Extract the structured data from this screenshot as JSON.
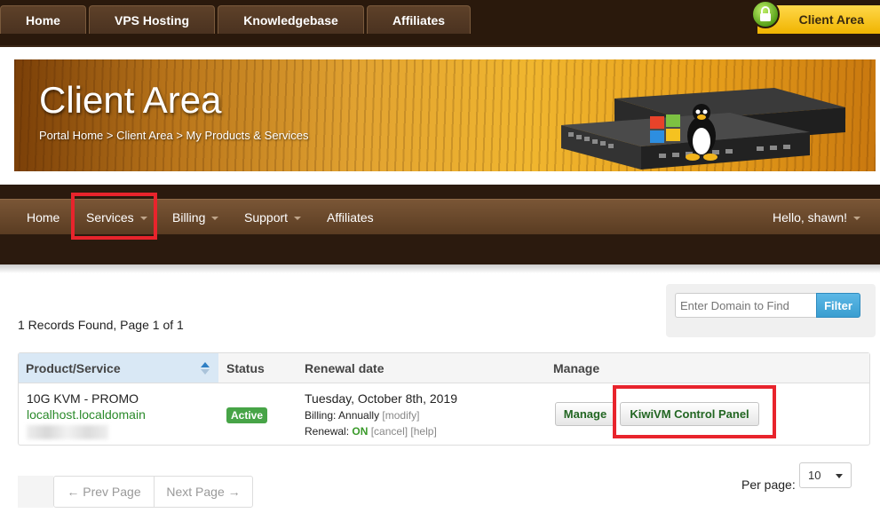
{
  "top_tabs": [
    "Home",
    "VPS Hosting",
    "Knowledgebase",
    "Affiliates"
  ],
  "client_area_tab": "Client Area",
  "banner": {
    "title": "Client Area",
    "breadcrumb": [
      "Portal Home",
      "Client Area",
      "My Products & Services"
    ],
    "breadcrumb_sep": ">"
  },
  "nav": {
    "items": [
      "Home",
      "Services",
      "Billing",
      "Support",
      "Affiliates"
    ],
    "greeting": "Hello, shawn!"
  },
  "records": {
    "prefix": "1 Records Found, Page ",
    "page": "1",
    "middle": " of ",
    "total": "1"
  },
  "filter": {
    "placeholder": "Enter Domain to Find",
    "button": "Filter"
  },
  "table": {
    "headers": [
      "Product/Service",
      "Status",
      "Renewal date",
      "Manage"
    ],
    "row": {
      "product": "10G KVM - PROMO",
      "domain": "localhost.localdomain",
      "status": "Active",
      "renewal_date": "Tuesday, October 8th, 2019",
      "billing_label": "Billing: ",
      "billing_value": "Annually",
      "modify": "[modify]",
      "renewal_label": "Renewal: ",
      "renewal_value": "ON",
      "cancel": "[cancel]",
      "help": "[help]",
      "manage_button": "Manage",
      "kiwi_button": "KiwiVM Control Panel"
    }
  },
  "pager": {
    "prev": "← Prev Page",
    "next": "Next Page →"
  },
  "per_page": {
    "label": "Per page:",
    "value": "10"
  },
  "colors": {
    "highlight": "#e8242c",
    "accent_yellow": "#f0b400",
    "active_green": "#47a447",
    "filter_blue": "#3a9ed0"
  }
}
